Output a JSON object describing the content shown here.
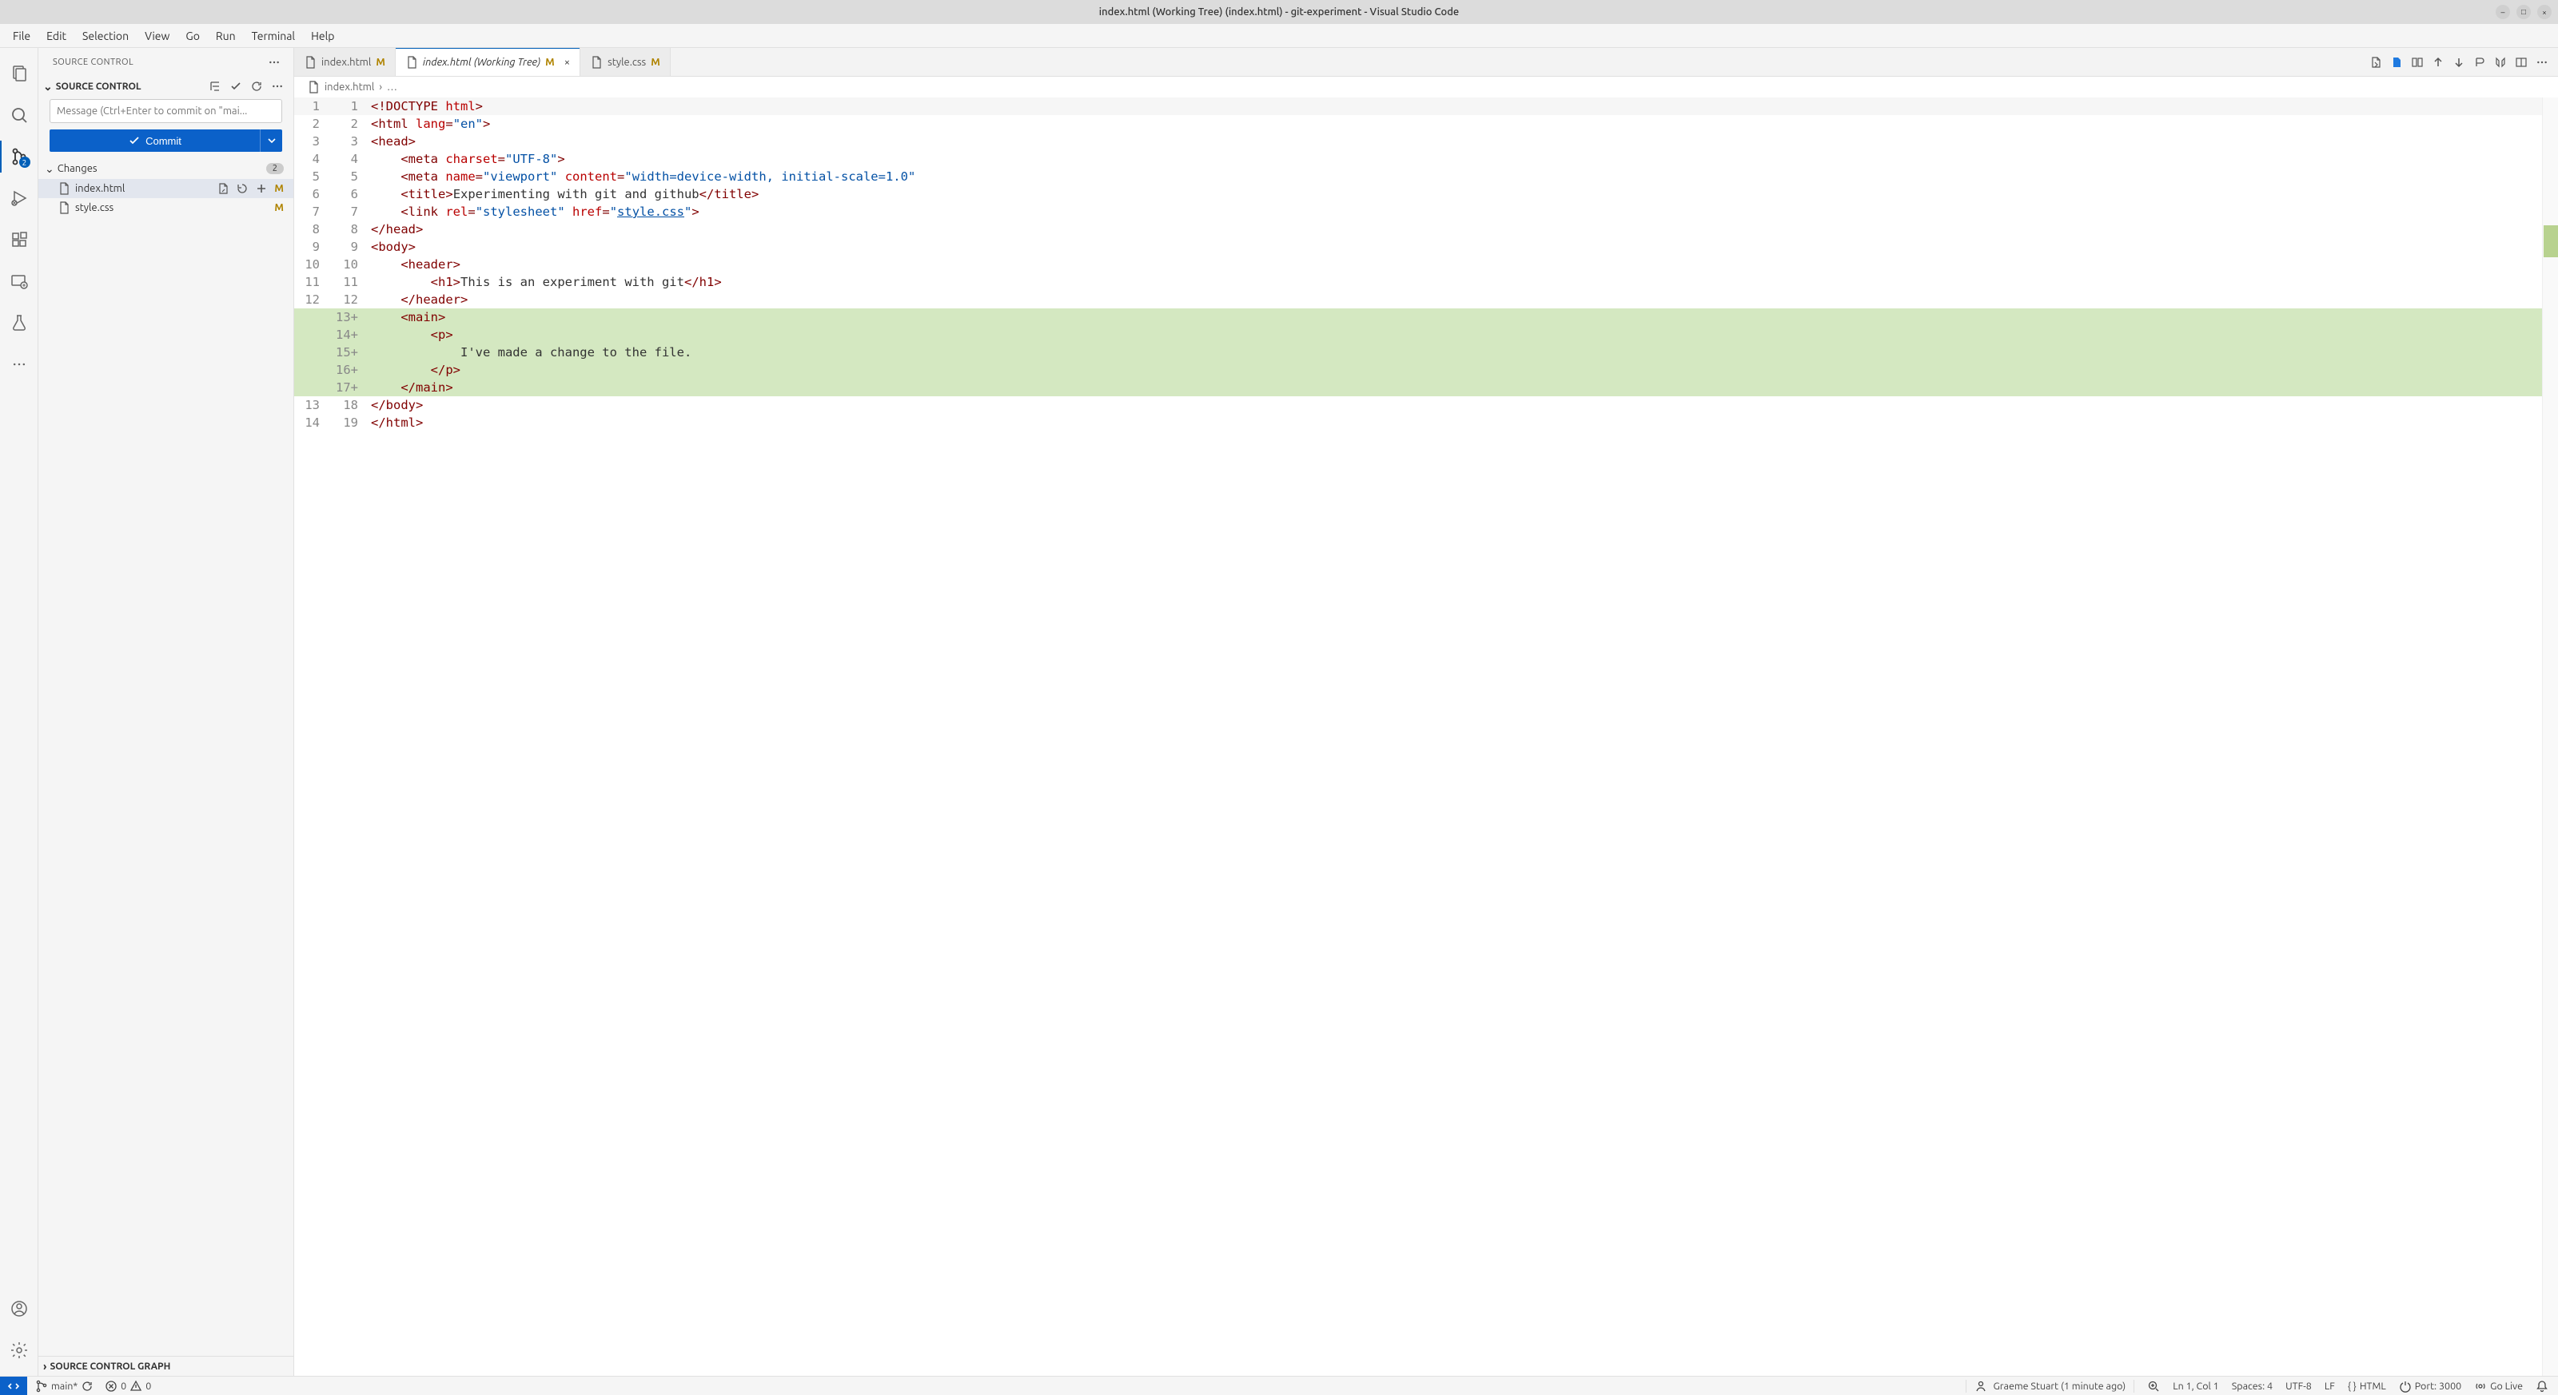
{
  "titlebar": {
    "title": "index.html (Working Tree) (index.html) - git-experiment - Visual Studio Code"
  },
  "menubar": [
    "File",
    "Edit",
    "Selection",
    "View",
    "Go",
    "Run",
    "Terminal",
    "Help"
  ],
  "activitybar": {
    "scm_badge": "2"
  },
  "sidebar": {
    "title": "SOURCE CONTROL",
    "section_title": "SOURCE CONTROL",
    "commit_placeholder": "Message (Ctrl+Enter to commit on \"mai...",
    "commit_button": "Commit",
    "changes_label": "Changes",
    "changes_count": "2",
    "files": [
      {
        "name": "index.html",
        "status": "M",
        "active": true
      },
      {
        "name": "style.css",
        "status": "M",
        "active": false
      }
    ],
    "graph_title": "SOURCE CONTROL GRAPH"
  },
  "tabs": [
    {
      "label": "index.html",
      "status": "M",
      "active": false,
      "italic": false,
      "close": false
    },
    {
      "label": "index.html (Working Tree)",
      "status": "M",
      "active": true,
      "italic": true,
      "close": true
    },
    {
      "label": "style.css",
      "status": "M",
      "active": false,
      "italic": false,
      "close": false
    }
  ],
  "breadcrumb": {
    "file": "index.html",
    "rest": "…"
  },
  "code": [
    {
      "l": "1",
      "r": "1",
      "added": false,
      "html": "<span class='punct'>&lt;!</span><span class='tok-doctype'>DOCTYPE</span> <span class='tok-doctype-kw'>html</span><span class='punct'>&gt;</span>"
    },
    {
      "l": "2",
      "r": "2",
      "added": false,
      "html": "<span class='punct'>&lt;</span><span class='tok-tag'>html</span> <span class='tok-attr'>lang</span><span class='punct'>=</span><span class='tok-str'>\"en\"</span><span class='punct'>&gt;</span>"
    },
    {
      "l": "3",
      "r": "3",
      "added": false,
      "html": "<span class='punct'>&lt;</span><span class='tok-tag'>head</span><span class='punct'>&gt;</span>"
    },
    {
      "l": "4",
      "r": "4",
      "added": false,
      "html": "    <span class='punct'>&lt;</span><span class='tok-tag'>meta</span> <span class='tok-attr'>charset</span><span class='punct'>=</span><span class='tok-str'>\"UTF-8\"</span><span class='punct'>&gt;</span>"
    },
    {
      "l": "5",
      "r": "5",
      "added": false,
      "html": "    <span class='punct'>&lt;</span><span class='tok-tag'>meta</span> <span class='tok-attr'>name</span><span class='punct'>=</span><span class='tok-str'>\"viewport\"</span> <span class='tok-attr'>content</span><span class='punct'>=</span><span class='tok-str'>\"width=device-width, initial-scale=1.0\"</span>"
    },
    {
      "l": "6",
      "r": "6",
      "added": false,
      "html": "    <span class='punct'>&lt;</span><span class='tok-tag'>title</span><span class='punct'>&gt;</span><span class='tok-text'>Experimenting with git and github</span><span class='punct'>&lt;/</span><span class='tok-tag'>title</span><span class='punct'>&gt;</span>"
    },
    {
      "l": "7",
      "r": "7",
      "added": false,
      "html": "    <span class='punct'>&lt;</span><span class='tok-tag'>link</span> <span class='tok-attr'>rel</span><span class='punct'>=</span><span class='tok-str'>\"stylesheet\"</span> <span class='tok-attr'>href</span><span class='punct'>=</span><span class='tok-str'>\"</span><span class='tok-link'>style.css</span><span class='tok-str'>\"</span><span class='punct'>&gt;</span>"
    },
    {
      "l": "8",
      "r": "8",
      "added": false,
      "html": "<span class='punct'>&lt;/</span><span class='tok-tag'>head</span><span class='punct'>&gt;</span>"
    },
    {
      "l": "9",
      "r": "9",
      "added": false,
      "html": "<span class='punct'>&lt;</span><span class='tok-tag'>body</span><span class='punct'>&gt;</span>"
    },
    {
      "l": "10",
      "r": "10",
      "added": false,
      "html": "    <span class='punct'>&lt;</span><span class='tok-tag'>header</span><span class='punct'>&gt;</span>"
    },
    {
      "l": "11",
      "r": "11",
      "added": false,
      "html": "        <span class='punct'>&lt;</span><span class='tok-tag'>h1</span><span class='punct'>&gt;</span><span class='tok-text'>This is an experiment with git</span><span class='punct'>&lt;/</span><span class='tok-tag'>h1</span><span class='punct'>&gt;</span>"
    },
    {
      "l": "12",
      "r": "12",
      "added": false,
      "html": "    <span class='punct'>&lt;/</span><span class='tok-tag'>header</span><span class='punct'>&gt;</span>"
    },
    {
      "l": "",
      "r": "13+",
      "added": true,
      "html": "    <span class='punct'>&lt;</span><span class='tok-tag'>main</span><span class='punct'>&gt;</span>"
    },
    {
      "l": "",
      "r": "14+",
      "added": true,
      "html": "        <span class='punct'>&lt;</span><span class='tok-tag'>p</span><span class='punct'>&gt;</span>"
    },
    {
      "l": "",
      "r": "15+",
      "added": true,
      "html": "            <span class='tok-text'>I've made a change to the file.</span>"
    },
    {
      "l": "",
      "r": "16+",
      "added": true,
      "html": "        <span class='punct'>&lt;/</span><span class='tok-tag'>p</span><span class='punct'>&gt;</span>"
    },
    {
      "l": "",
      "r": "17+",
      "added": true,
      "html": "    <span class='punct'>&lt;/</span><span class='tok-tag'>main</span><span class='punct'>&gt;</span>"
    },
    {
      "l": "13",
      "r": "18",
      "added": false,
      "html": "<span class='punct'>&lt;/</span><span class='tok-tag'>body</span><span class='punct'>&gt;</span>"
    },
    {
      "l": "14",
      "r": "19",
      "added": false,
      "html": "<span class='punct'>&lt;/</span><span class='tok-tag'>html</span><span class='punct'>&gt;</span>"
    }
  ],
  "statusbar": {
    "branch": "main*",
    "sync_icon": "⟳",
    "errors": "0",
    "warnings": "0",
    "blame_author": "Graeme Stuart (1 minute ago)",
    "cursor": "Ln 1, Col 1",
    "spaces": "Spaces: 4",
    "encoding": "UTF-8",
    "eol": "LF",
    "lang": "HTML",
    "port": "Port: 3000",
    "golive": "Go Live"
  }
}
